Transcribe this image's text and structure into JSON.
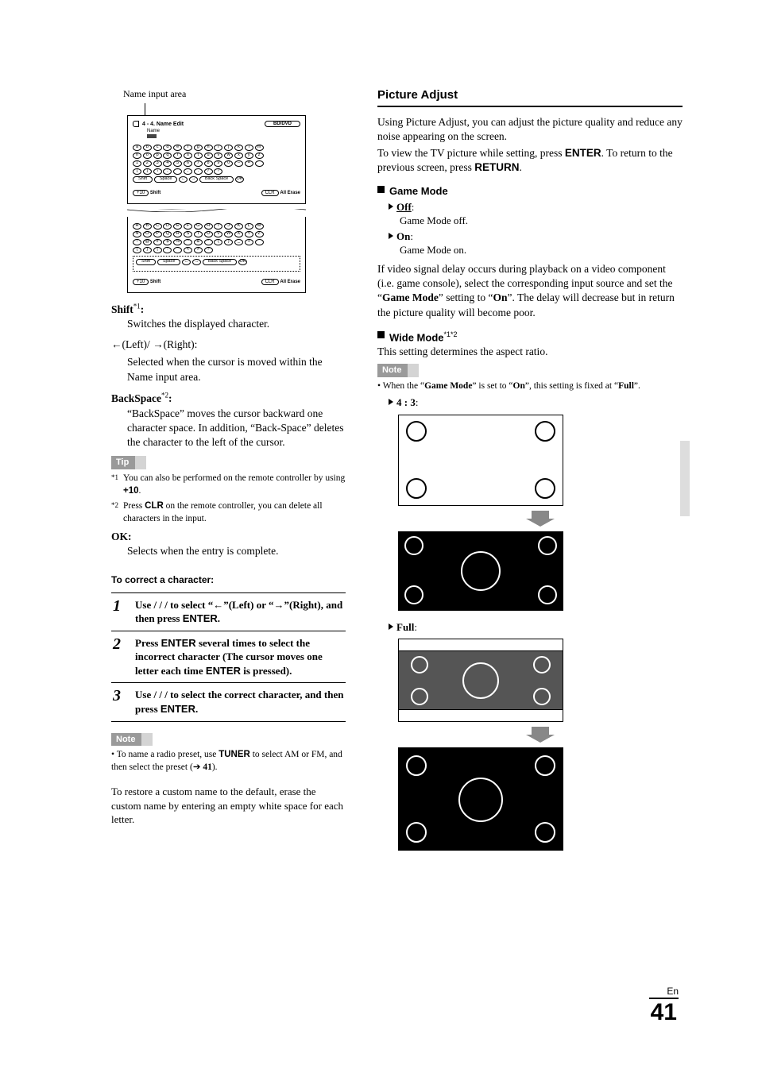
{
  "left": {
    "name_input_caption": "Name input area",
    "osd": {
      "title": "4 - 4. Name  Edit",
      "badge": "BD/DVD",
      "sub": "Name",
      "rows_lower": [
        [
          "a",
          "b",
          "c",
          "d",
          "e",
          "f",
          "g",
          "h",
          "i",
          "j",
          "k",
          "l",
          "m"
        ],
        [
          "n",
          "o",
          "p",
          "q",
          "r",
          "s",
          "t",
          "u",
          "v",
          "w",
          "x",
          "y",
          "z"
        ],
        [
          "1",
          "2",
          "3",
          "4",
          "5",
          "6",
          "7",
          "8",
          "9",
          "0",
          "–",
          "=",
          ""
        ],
        [
          "[",
          "]",
          "\\",
          ";",
          "'",
          ",",
          ".",
          "/",
          "?"
        ]
      ],
      "rows_upper": [
        [
          "A",
          "B",
          "C",
          "D",
          "E",
          "F",
          "G",
          "H",
          "I",
          "J",
          "K",
          "L",
          "M"
        ],
        [
          "N",
          "O",
          "P",
          "Q",
          "R",
          "S",
          "T",
          "U",
          "V",
          "W",
          "X",
          "Y",
          "Z"
        ],
        [
          "!",
          "@",
          "#",
          "$",
          "%",
          "^",
          "&",
          "*",
          "(",
          ")",
          "_",
          "+",
          ""
        ],
        [
          "{",
          "}",
          "|",
          ":",
          "\"",
          "<",
          ">",
          "?"
        ]
      ],
      "fn_row": [
        "Shift",
        "Space",
        "←",
        "→",
        "Back Space",
        "OK"
      ],
      "foot_left_pill": "+10",
      "foot_left_label": "Shift",
      "foot_right_pill": "CLR",
      "foot_right_label": "All Erase"
    },
    "shift_label": "Shift",
    "shift_sup": "*1",
    "shift_colon": ":",
    "shift_desc": "Switches the displayed character.",
    "arrows_label": "←(Left)/ →(Right):",
    "arrows_desc": "Selected when the cursor is moved within the Name input area.",
    "backspace_label": "BackSpace",
    "backspace_sup": "*2",
    "backspace_colon": ":",
    "backspace_desc": "“BackSpace” moves the cursor backward one character space. In addition, “Back-Space” deletes the character to the left of the cursor.",
    "tip_box": "Tip",
    "fn1_sup": "*1",
    "fn1_a": "You can also be performed on the remote controller by using ",
    "fn1_b": "+10",
    "fn1_c": ".",
    "fn2_sup": "*2",
    "fn2_a": "Press ",
    "fn2_b": "CLR",
    "fn2_c": " on the remote controller, you can delete all characters in the input.",
    "ok_label": "OK:",
    "ok_desc": "Selects when the entry is complete.",
    "to_correct": "To correct a character:",
    "steps": [
      {
        "n": "1",
        "pre": "Use ",
        "arrows": " /  /  / ",
        "mid": " to select “←”(Left) or “→”(Right), and then press ",
        "enter": "ENTER",
        "post": "."
      },
      {
        "n": "2",
        "pre": "Press ",
        "enter1": "ENTER",
        "mid1": " several times to select the incorrect character (The cursor moves one letter each time ",
        "enter2": "ENTER",
        "post": " is pressed)."
      },
      {
        "n": "3",
        "pre": "Use ",
        "arrows": " /  /  / ",
        "mid": " to select the correct character, and then press ",
        "enter": "ENTER",
        "post": "."
      }
    ],
    "note_box": "Note",
    "note1_a": "• To name a radio preset, use ",
    "note1_b": "TUNER",
    "note1_c": " to select AM or FM, and then select the preset (",
    "note1_arrow": "➔",
    "note1_d": " 41",
    "note1_e": ").",
    "restore": "To restore a custom name to the default, erase the custom name by entering an empty white space for each letter."
  },
  "right": {
    "heading": "Picture Adjust",
    "intro1": "Using Picture Adjust, you can adjust the picture quality and reduce any noise appearing on the screen.",
    "intro2_a": "To view the TV picture while setting, press ",
    "intro2_b": "ENTER",
    "intro2_c": ". To return to the previous screen, press ",
    "intro2_d": "RETURN",
    "intro2_e": ".",
    "game_mode_title": "Game Mode",
    "off_label": "Off",
    "off_colon": ":",
    "off_desc": "Game Mode off.",
    "on_label": "On",
    "on_colon": ":",
    "on_desc": "Game Mode on.",
    "game_note_a": "If video signal delay occurs during playback on a video component (i.e. game console), select the corresponding input source and set the “",
    "game_note_b": "Game Mode",
    "game_note_c": "” setting to “",
    "game_note_d": "On",
    "game_note_e": "”. The delay will decrease but in return the picture quality will become poor.",
    "wide_mode_title": "Wide Mode",
    "wide_sup": "*1*2",
    "wide_desc": "This setting determines the aspect ratio.",
    "wide_note_box": "Note",
    "wide_note_a": "• When the “",
    "wide_note_b": "Game Mode",
    "wide_note_c": "” is set to “",
    "wide_note_d": "On",
    "wide_note_e": "”, this setting is fixed at “",
    "wide_note_f": "Full",
    "wide_note_g": "”.",
    "ratio_43": "4 : 3",
    "ratio_43_colon": ":",
    "ratio_full": "Full",
    "ratio_full_colon": ":"
  },
  "page": {
    "lang": "En",
    "num": "41"
  }
}
